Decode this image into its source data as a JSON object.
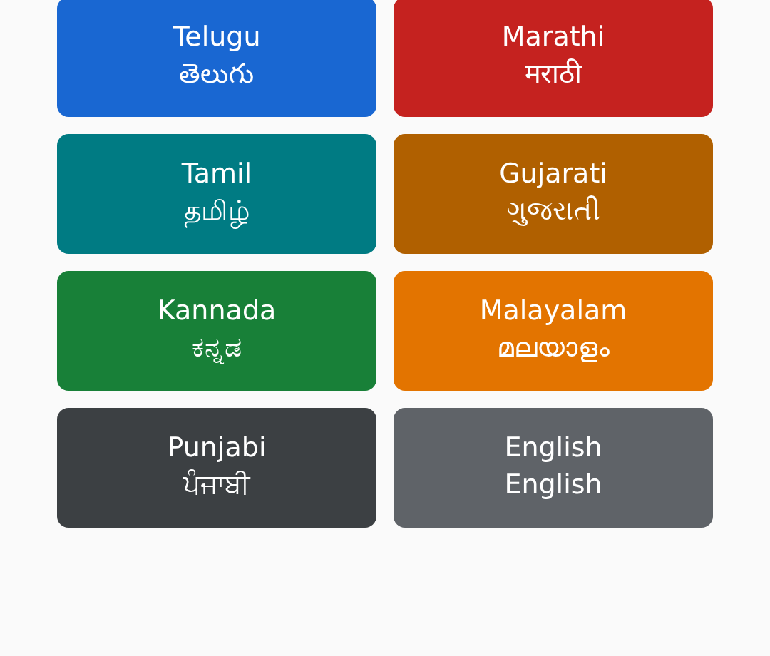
{
  "languages": [
    {
      "name": "Telugu",
      "native": "తెలుగు",
      "color": "#1967d2"
    },
    {
      "name": "Marathi",
      "native": "मराठी",
      "color": "#c5221f"
    },
    {
      "name": "Tamil",
      "native": "தமிழ்",
      "color": "#007b83"
    },
    {
      "name": "Gujarati",
      "native": "ગુજરાતી",
      "color": "#b06000"
    },
    {
      "name": "Kannada",
      "native": "ಕನ್ನಡ",
      "color": "#188038"
    },
    {
      "name": "Malayalam",
      "native": "മലയാളം",
      "color": "#e37400"
    },
    {
      "name": "Punjabi",
      "native": "ਪੰਜਾਬੀ",
      "color": "#3c4043"
    },
    {
      "name": "English",
      "native": "English",
      "color": "#5f6368"
    }
  ]
}
